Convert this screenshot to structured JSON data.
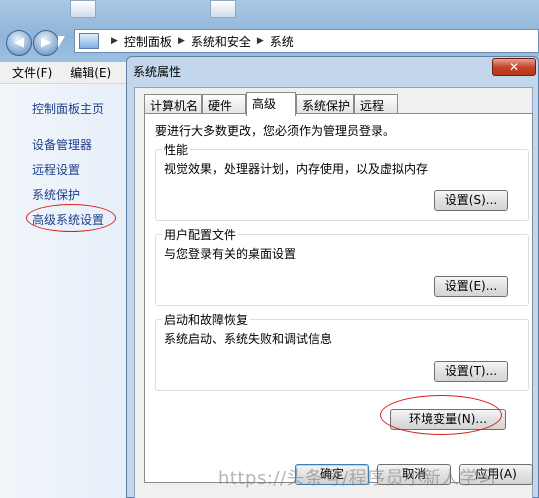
{
  "window": {
    "address_crumbs": [
      "控制面板",
      "系统和安全",
      "系统"
    ],
    "menu": [
      "文件(F)",
      "编辑(E)"
    ],
    "nav_back": "◀",
    "nav_forward": "▶"
  },
  "sidebar": {
    "items": [
      "控制面板主页",
      "设备管理器",
      "远程设置",
      "系统保护",
      "高级系统设置"
    ]
  },
  "dialog": {
    "title": "系统属性",
    "close_label": "✕",
    "tabs": [
      "计算机名",
      "硬件",
      "高级",
      "系统保护",
      "远程"
    ],
    "active_tab": "高级",
    "admin_note": "要进行大多数更改，您必须作为管理员登录。",
    "groups": [
      {
        "title": "性能",
        "desc": "视觉效果，处理器计划，内存使用，以及虚拟内存",
        "button": "设置(S)..."
      },
      {
        "title": "用户配置文件",
        "desc": "与您登录有关的桌面设置",
        "button": "设置(E)..."
      },
      {
        "title": "启动和故障恢复",
        "desc": "系统启动、系统失败和调试信息",
        "button": "设置(T)..."
      }
    ],
    "env_button": "环境变量(N)...",
    "ok_button": "确定",
    "cancel_button": "取消",
    "apply_button": "应用(A)"
  },
  "watermark": "https://头条号/程序员小新人学习",
  "colors": {
    "highlight_circle": "#d62020",
    "sidebar_link": "#1e3f8a",
    "close_button": "#c7462b"
  }
}
